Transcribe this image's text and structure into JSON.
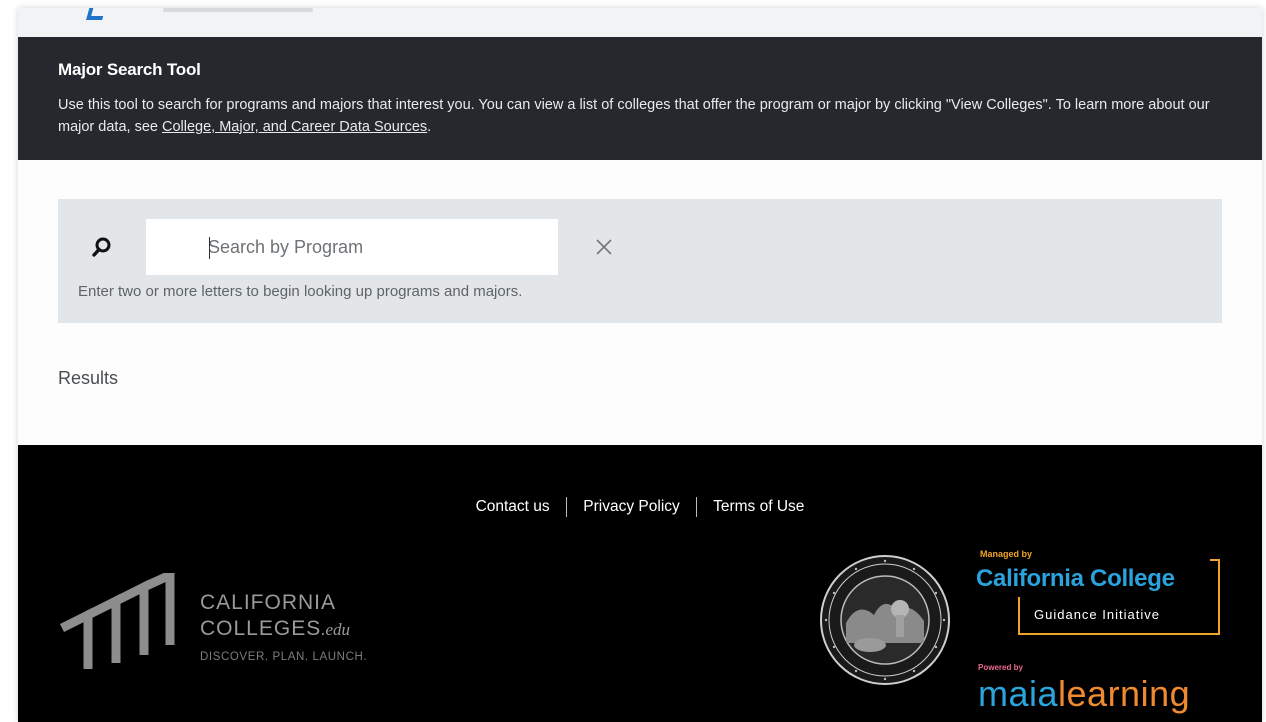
{
  "header": {
    "title": "Major Search Tool",
    "description_prefix": "Use this tool to search for programs and majors that interest you. You can view a list of colleges that offer the program or major by clicking \"View Colleges\". To learn more about our major data, see ",
    "description_link": "College, Major, and Career Data Sources",
    "description_suffix": "."
  },
  "search": {
    "placeholder": "Search by Program",
    "value": "",
    "hint": "Enter two or more letters to begin looking up programs and majors.",
    "icon": "search-icon",
    "clear_icon": "close-icon"
  },
  "results": {
    "label": "Results"
  },
  "footer": {
    "links": [
      "Contact us",
      "Privacy Policy",
      "Terms of Use"
    ],
    "cc_line1": "CALIFORNIA",
    "cc_line2": "COLLEGES",
    "cc_line2_suffix": ".edu",
    "cc_tagline": "DISCOVER. PLAN. LAUNCH.",
    "managed_by": "Managed by",
    "ccgi_name": "California College",
    "ccgi_sub": "Guidance Initiative",
    "powered_by": "Powered by",
    "maia_part1": "maia",
    "maia_part2": "learning"
  },
  "colors": {
    "hero_bg": "#25282d",
    "search_panel_bg": "#e2e6e8",
    "footer_bg": "#000000",
    "ccgi_blue": "#29a3dd",
    "ccgi_orange": "#f0a524"
  }
}
